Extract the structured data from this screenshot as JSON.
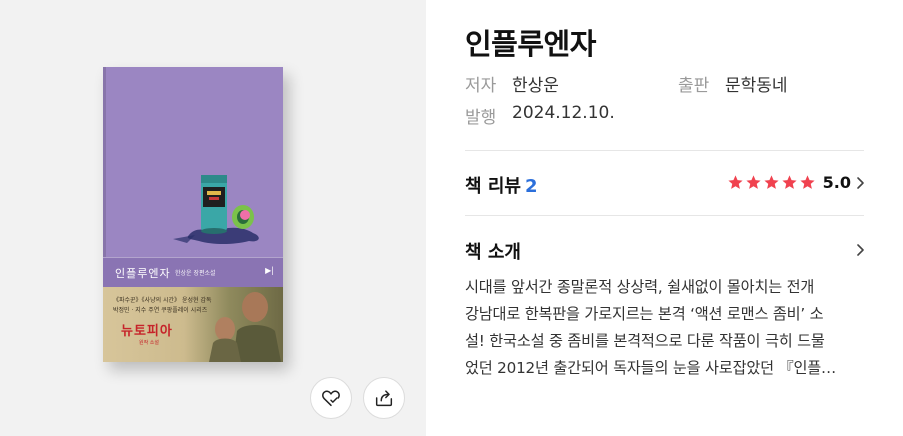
{
  "book": {
    "title": "인플루엔자",
    "author_label": "저자",
    "author": "한상운",
    "publisher_label": "출판",
    "publisher": "문학동네",
    "date_label": "발행",
    "date": "2024.12.10."
  },
  "cover": {
    "title": "인플루엔자",
    "author_line": "한상운 장편소설",
    "belt_line1": "《파수꾼》《사냥의 시간》 윤성현 감독",
    "belt_line2": "박정민 · 지수 주연 쿠팡플레이 시리즈",
    "belt_brand": "뉴토피아",
    "belt_sub": "원작 소설",
    "bg_color": "#9b86c2",
    "band_color": "#8a74b3"
  },
  "review": {
    "heading": "책 리뷰",
    "count": "2",
    "rating": 5.0,
    "score": "5.0",
    "star_color": "#f0424f"
  },
  "intro": {
    "heading": "책 소개",
    "lines": [
      "시대를 앞서간 종말론적 상상력, 쉴새없이 몰아치는 전개",
      "강남대로 한복판을 가로지르는 본격 ‘액션 로맨스 좀비’ 소",
      "설! 한국소설 중 좀비를 본격적으로 다룬 작품이 극히 드물",
      "었던 2012년 출간되어 독자들의 눈을 사로잡았던 『인플…"
    ]
  },
  "actions": {
    "like_icon": "heart-check-icon",
    "share_icon": "share-icon"
  },
  "colors": {
    "accent_blue": "#2b6fdb",
    "left_panel_bg": "#f2f2f2"
  }
}
